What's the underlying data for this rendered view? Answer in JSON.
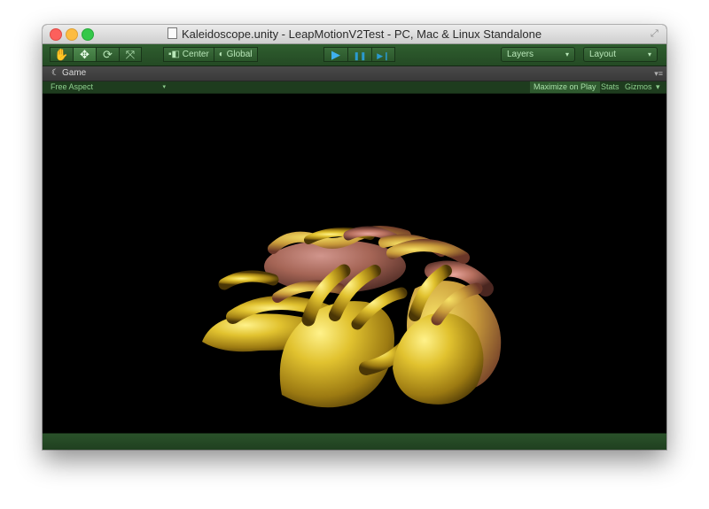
{
  "window": {
    "title": "Kaleidoscope.unity - LeapMotionV2Test - PC, Mac & Linux Standalone"
  },
  "toolbar": {
    "tools": [
      {
        "name": "hand-tool",
        "icon": "hand-icon",
        "glyph": "✋"
      },
      {
        "name": "move-tool",
        "icon": "move-icon",
        "glyph": "✥"
      },
      {
        "name": "rotate-tool",
        "icon": "rotate-icon",
        "glyph": "⟳"
      },
      {
        "name": "scale-tool",
        "icon": "scale-icon",
        "glyph": "⤧"
      }
    ],
    "pivot_label": "Center",
    "space_label": "Global",
    "play_glyph": "▶",
    "pause_glyph": "❚❚",
    "step_glyph": "▶❙",
    "layers_label": "Layers",
    "layout_label": "Layout",
    "caret": "▾"
  },
  "tab": {
    "label": "Game",
    "menu_glyph": "▾≡"
  },
  "gamebar": {
    "aspect": "Free Aspect",
    "maximize": "Maximize on Play",
    "stats": "Stats",
    "gizmos": "Gizmos",
    "caret": "▾"
  },
  "colors": {
    "toolbar_green": "#2f5e2f",
    "play_blue": "#3fb0ee",
    "hand_gold": "#d9b52a",
    "hand_pink": "#c07a78"
  }
}
